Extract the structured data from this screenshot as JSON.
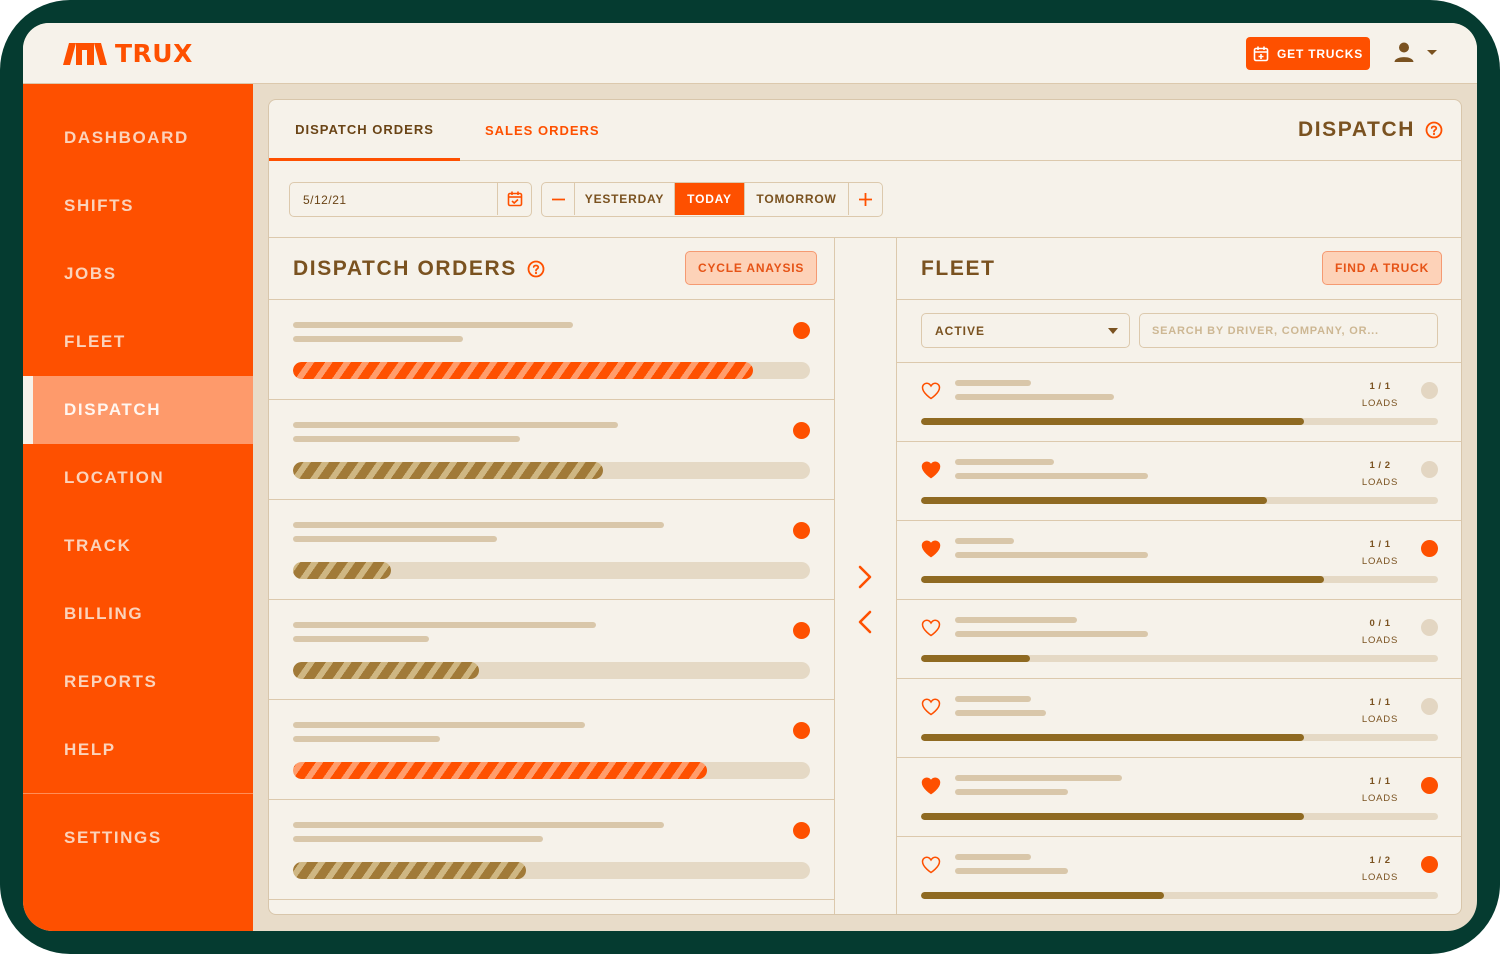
{
  "brand": {
    "name": "TRUX",
    "accent": "#fe5000",
    "frame": "#053b30"
  },
  "header": {
    "get_trucks_label": "GET TRUCKS"
  },
  "sidebar": {
    "items": [
      {
        "label": "DASHBOARD",
        "active": false
      },
      {
        "label": "SHIFTS",
        "active": false
      },
      {
        "label": "JOBS",
        "active": false
      },
      {
        "label": "FLEET",
        "active": false
      },
      {
        "label": "DISPATCH",
        "active": true
      },
      {
        "label": "LOCATION",
        "active": false
      },
      {
        "label": "TRACK",
        "active": false
      },
      {
        "label": "BILLING",
        "active": false
      },
      {
        "label": "REPORTS",
        "active": false
      },
      {
        "label": "HELP",
        "active": false
      }
    ],
    "settings_label": "SETTINGS"
  },
  "tabs": {
    "dispatch_orders": "DISPATCH ORDERS",
    "sales_orders": "SALES ORDERS"
  },
  "page_title": "DISPATCH",
  "date_controls": {
    "date": "5/12/21",
    "yesterday": "YESTERDAY",
    "today": "TODAY",
    "tomorrow": "TOMORROW",
    "minus": "—",
    "plus": "+"
  },
  "dispatch_panel": {
    "title": "DISPATCH ORDERS",
    "cycle_button": "CYCLE ANAYSIS",
    "orders": [
      {
        "progress": 0.89,
        "color": "orange"
      },
      {
        "progress": 0.6,
        "color": "brown"
      },
      {
        "progress": 0.19,
        "color": "brown"
      },
      {
        "progress": 0.36,
        "color": "brown"
      },
      {
        "progress": 0.8,
        "color": "orange"
      },
      {
        "progress": 0.45,
        "color": "brown"
      }
    ]
  },
  "fleet_panel": {
    "title": "FLEET",
    "find_button": "FIND A TRUCK",
    "filter_value": "ACTIVE",
    "search_placeholder": "SEARCH BY DRIVER, COMPANY, OR...",
    "loads_label": "LOADS",
    "trucks": [
      {
        "loads": "1 / 1",
        "favorite": false,
        "status": "off",
        "progress": 0.74
      },
      {
        "loads": "1 / 2",
        "favorite": true,
        "status": "off",
        "progress": 0.67
      },
      {
        "loads": "1 / 1",
        "favorite": true,
        "status": "on",
        "progress": 0.78
      },
      {
        "loads": "0 / 1",
        "favorite": false,
        "status": "off",
        "progress": 0.21
      },
      {
        "loads": "1 / 1",
        "favorite": false,
        "status": "off",
        "progress": 0.74
      },
      {
        "loads": "1 / 1",
        "favorite": true,
        "status": "on",
        "progress": 0.74
      },
      {
        "loads": "1 / 2",
        "favorite": false,
        "status": "on",
        "progress": 0.47
      }
    ]
  }
}
